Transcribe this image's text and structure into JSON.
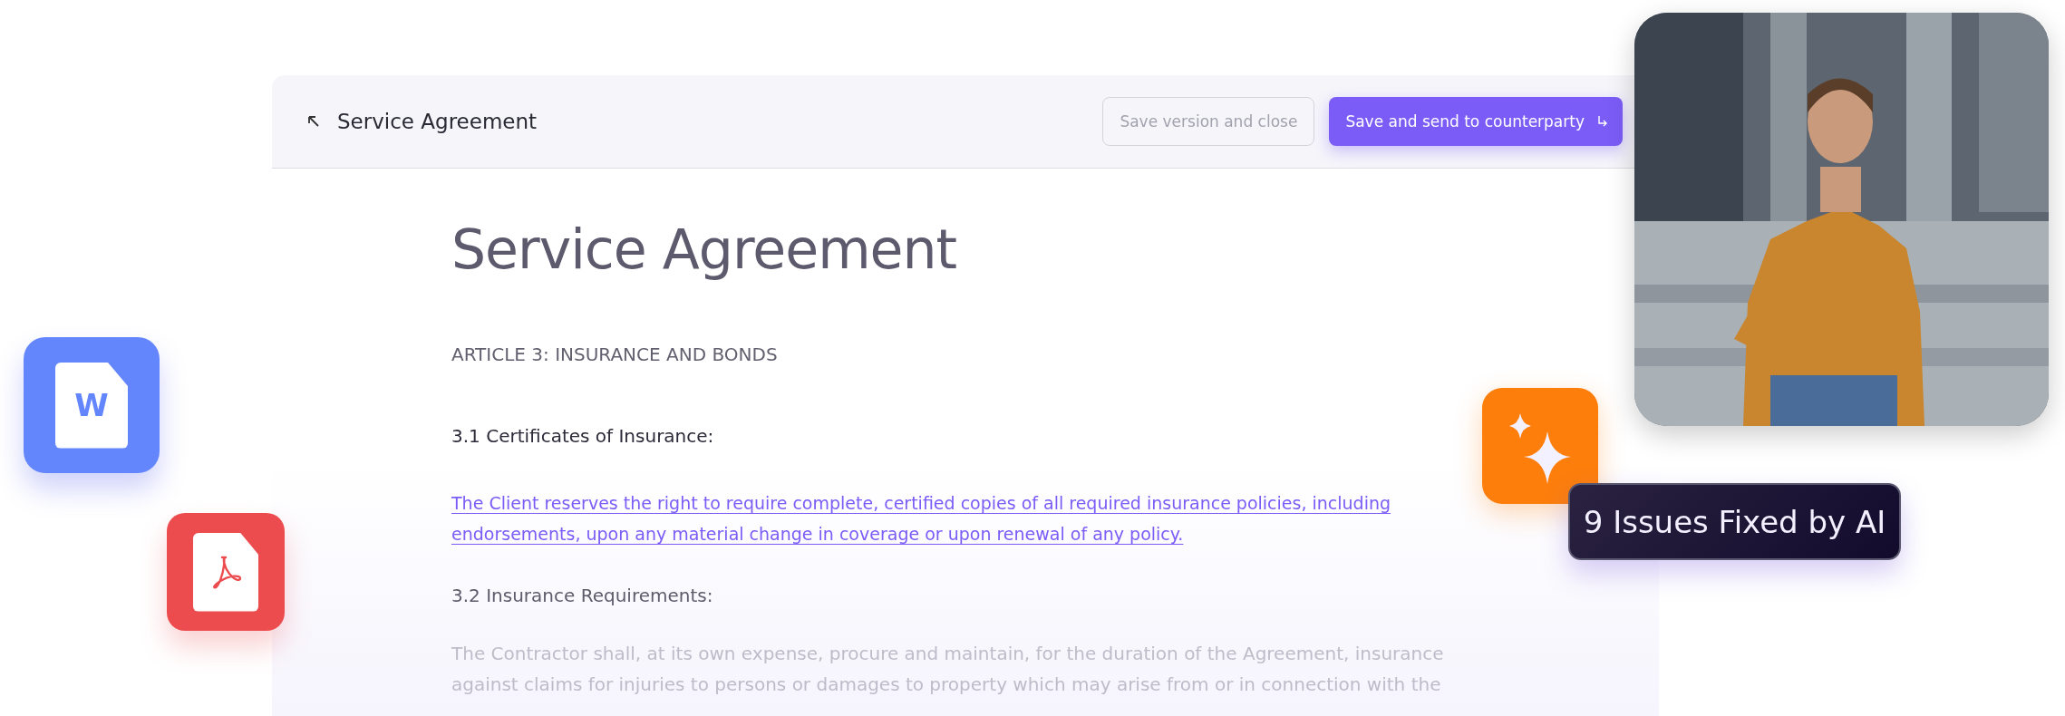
{
  "header": {
    "title": "Service Agreement",
    "buttons": [
      {
        "label": "Save version and close",
        "kind": "secondary"
      },
      {
        "label": "Save and send to counterparty",
        "kind": "primary"
      }
    ]
  },
  "document": {
    "title": "Service Agreement",
    "blocks": [
      {
        "kind": "article",
        "text": "ARTICLE 3: INSURANCE AND BONDS"
      },
      {
        "kind": "heading",
        "text": "3.1 Certificates of Insurance:"
      },
      {
        "kind": "link",
        "text": "The Client reserves the right to require complete, certified copies of all required insurance policies, including endorsements, upon any material change in coverage or upon renewal of any policy."
      },
      {
        "kind": "heading-muted",
        "text": "3.2 Insurance Requirements:"
      },
      {
        "kind": "faded",
        "text": "The Contractor shall, at its own expense, procure and maintain, for the duration of the Agreement, insurance against claims for injuries to persons or damages to property which may arise from or in connection with the"
      }
    ]
  },
  "file_icons": [
    {
      "kind": "word",
      "letter": "W"
    },
    {
      "kind": "pdf"
    }
  ],
  "ai_badge": {
    "text": "9 Issues Fixed by AI"
  }
}
